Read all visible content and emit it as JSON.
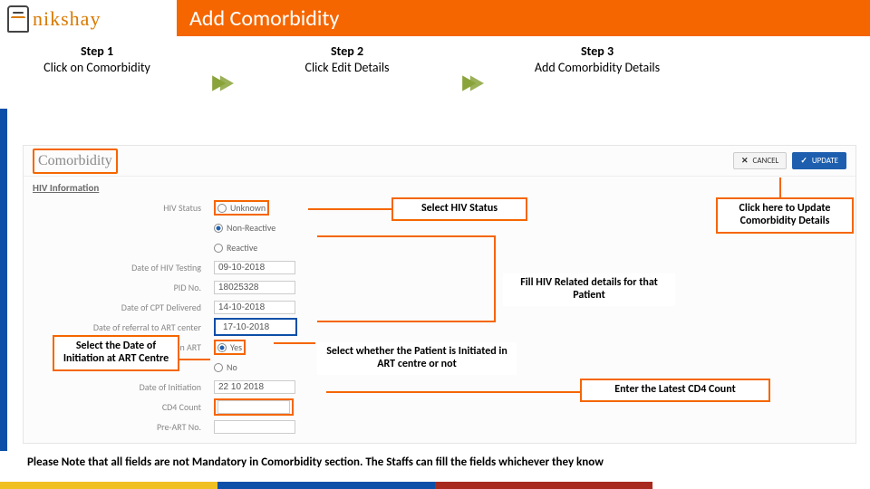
{
  "header": {
    "logo_text": "nikshay",
    "title": "Add Comorbidity"
  },
  "steps": [
    {
      "title": "Step 1",
      "desc": "Click on Comorbidity"
    },
    {
      "title": "Step 2",
      "desc": "Click Edit Details"
    },
    {
      "title": "Step 3",
      "desc": "Add Comorbidity Details"
    }
  ],
  "screenshot": {
    "tab_label": "Comorbidity",
    "cancel_label": "CANCEL",
    "update_label": "UPDATE",
    "subheading": "HIV Information",
    "fields": {
      "hiv_status": {
        "label": "HIV Status",
        "options": [
          "Unknown",
          "Non-Reactive",
          "Reactive"
        ],
        "selected": "Non-Reactive"
      },
      "date_hiv_testing": {
        "label": "Date of HIV Testing",
        "value": "09-10-2018"
      },
      "pid_no": {
        "label": "PID No.",
        "value": "18025328"
      },
      "date_cpt": {
        "label": "Date of CPT Delivered",
        "value": "14-10-2018"
      },
      "date_art_referral": {
        "label": "Date of referral to ART center",
        "value": "17-10-2018"
      },
      "initiated_art": {
        "label": "Initiated on ART",
        "options": [
          "Yes",
          "No"
        ],
        "selected": "Yes"
      },
      "date_initiation": {
        "label": "Date of Initiation",
        "value": "22 10 2018"
      },
      "cd4_count": {
        "label": "CD4 Count",
        "value": ""
      },
      "pre_art": {
        "label": "Pre-ART No.",
        "value": ""
      }
    }
  },
  "callouts": {
    "hiv_status": "Select HIV Status",
    "update": "Click here to Update Comorbidity Details",
    "fill_hiv": "Fill HIV Related details for that Patient",
    "date_init": "Select the Date of Initiation at ART Centre",
    "initiated": "Select whether the Patient is Initiated in ART centre or not",
    "cd4": "Enter the Latest CD4 Count"
  },
  "note": "Please Note that all fields are not Mandatory in Comorbidity section. The Staffs can fill the fields whichever they know"
}
